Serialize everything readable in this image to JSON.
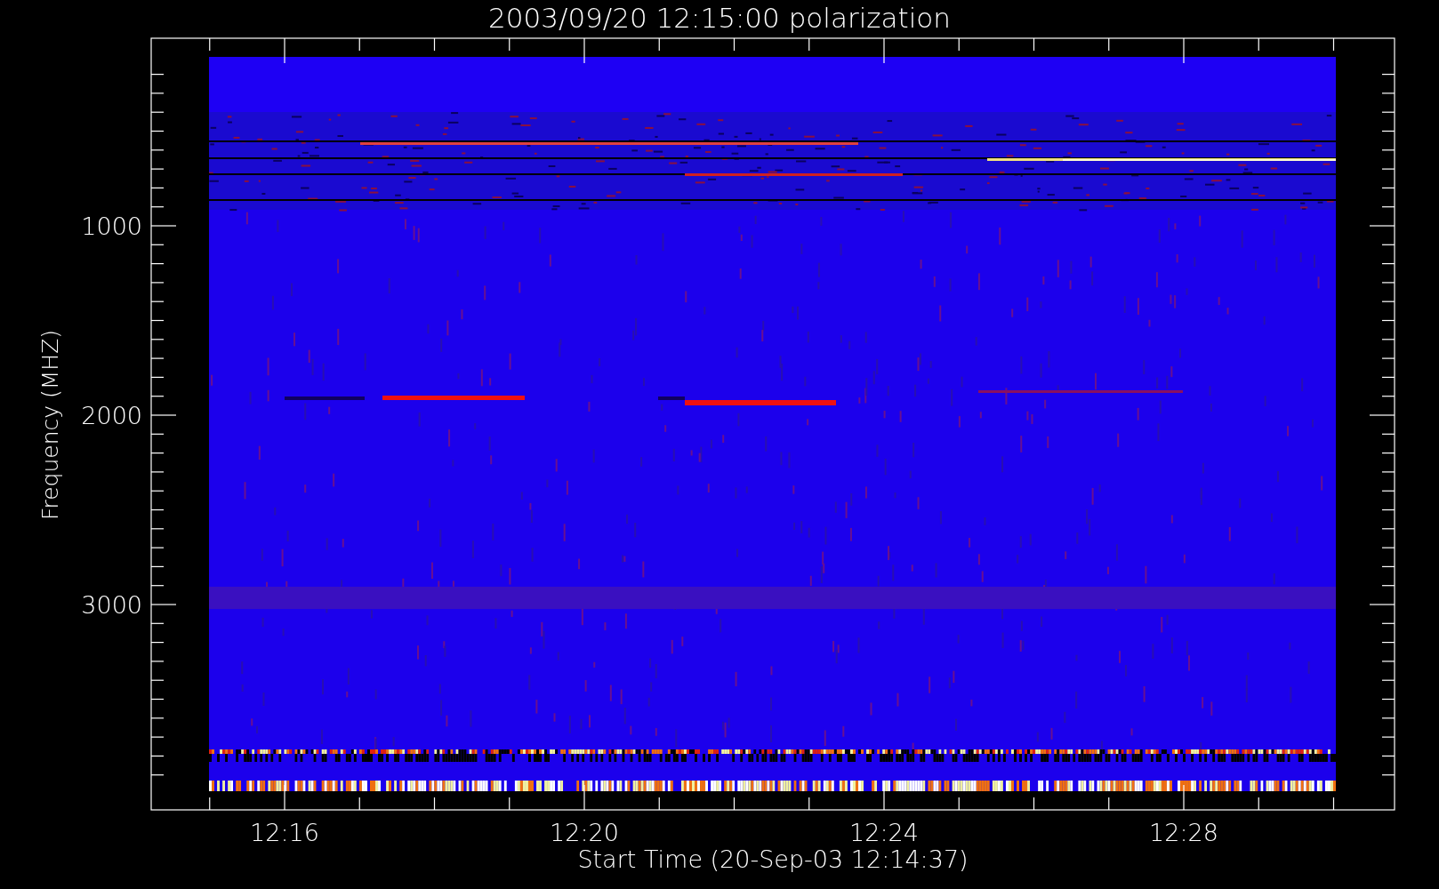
{
  "title": "2003/09/20 12:15:00 polarization",
  "xlabel": "Start Time (20-Sep-03 12:14:37)",
  "ylabel": "Frequency (MHZ)",
  "xticks": [
    {
      "label": "12:16"
    },
    {
      "label": "12:20"
    },
    {
      "label": "12:24"
    },
    {
      "label": "12:28"
    }
  ],
  "yticks": [
    {
      "label": "1000"
    },
    {
      "label": "2000"
    },
    {
      "label": "3000"
    }
  ]
}
